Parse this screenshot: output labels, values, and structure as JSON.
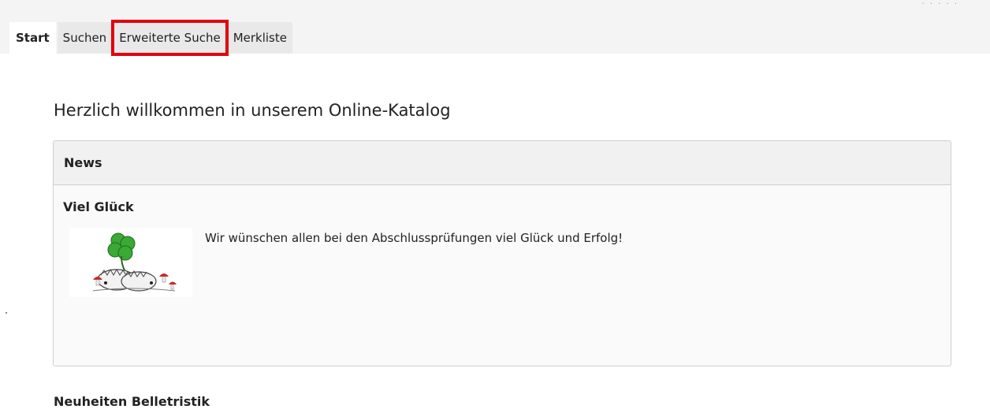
{
  "tabs": [
    {
      "label": "Start",
      "active": true
    },
    {
      "label": "Suchen",
      "active": false
    },
    {
      "label": "Erweiterte Suche",
      "active": false,
      "highlighted": true
    },
    {
      "label": "Merkliste",
      "active": false
    }
  ],
  "top_right_text": "· · · · ·",
  "page_title": "Herzlich willkommen in unserem Online-Katalog",
  "news": {
    "header": "News",
    "item_title": "Viel Glück",
    "item_text": "Wir wünschen allen bei den Abschlussprüfungen viel Glück und Erfolg!",
    "image_icon": "clover-hedgehog-illustration"
  },
  "next_section_title": "Neuheiten Belletristik",
  "colors": {
    "highlight": "#e3000f",
    "tab_bg": "#e9e9e9",
    "clover": "#3aa935"
  }
}
